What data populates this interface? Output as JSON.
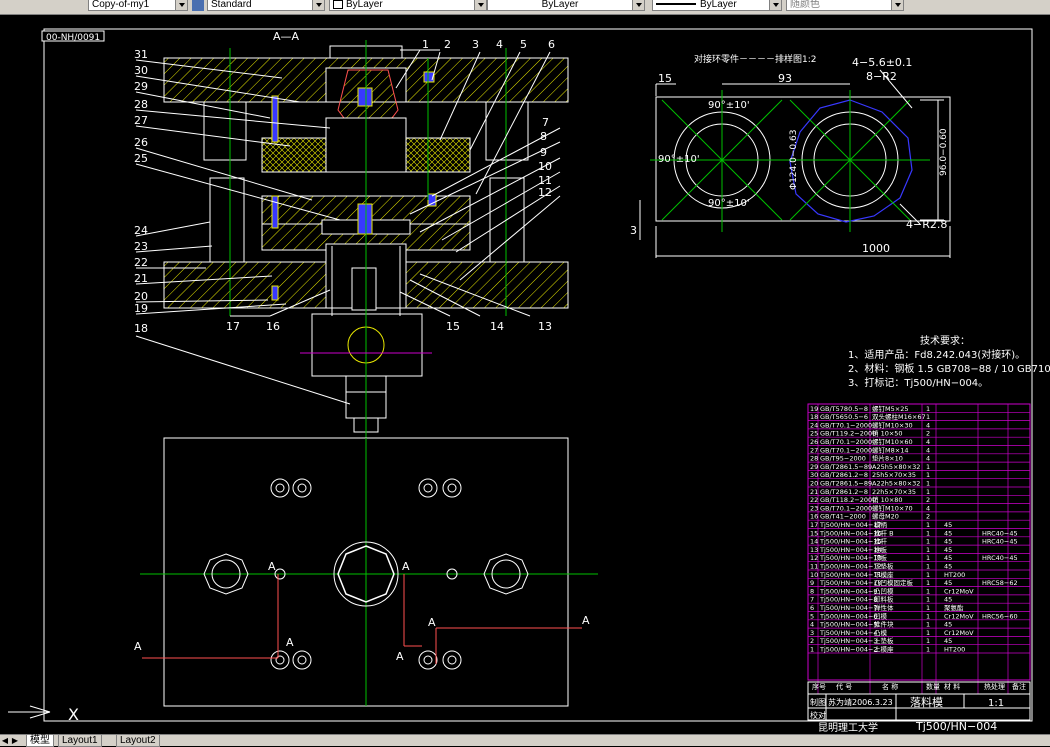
{
  "toolbar": {
    "layer_select": "Copy-of-my1",
    "text_style": "Standard",
    "color_control": "ByLayer",
    "linetype_control": "ByLayer",
    "lineweight_control": "ByLayer",
    "plot_style": "随颜色"
  },
  "drawing": {
    "top_label": "00-NH/0091",
    "section_label": "A—A",
    "part_numbers_left": [
      "31",
      "30",
      "29",
      "28",
      "27",
      "26",
      "25",
      "24",
      "23",
      "22",
      "21",
      "20",
      "19",
      "18"
    ],
    "part_numbers_top": [
      "1",
      "2",
      "3",
      "4",
      "5",
      "6"
    ],
    "part_numbers_right": [
      "7",
      "8",
      "9",
      "10",
      "11",
      "12"
    ],
    "part_numbers_bottom": [
      "17",
      "16",
      "15",
      "14",
      "13"
    ],
    "strip_title": "对接环零件－－－－排样图1:2",
    "dims": {
      "d15": "15",
      "d93": "93",
      "d_hole": "4−5.6±0.1",
      "d_r2": "8−R2",
      "a1": "90°±10'",
      "a2": "90°±10'",
      "a3": "90°±10'",
      "dia": "Φ124.0−0.63",
      "d96": "96.0−0.60",
      "d3": "3",
      "r28": "4−R2.8",
      "d1000": "1000"
    },
    "section_marks": [
      "A",
      "A",
      "A",
      "A",
      "A",
      "A",
      "A"
    ]
  },
  "tech": {
    "title": "技术要求：",
    "line1": "1、适用产品：Fd8.242.043(对接环)。",
    "line2": "2、材料：钢板 1.5 GB708−88 / 10 GB710−91",
    "line3": "3、打标记：Tj500/HN−004。"
  },
  "bom_std": [
    [
      "19",
      "GB/T5780.5−8",
      "螺钉M5×25",
      "1"
    ],
    [
      "18",
      "GB/T5650.5−6",
      "双头螺柱M16×67",
      "1"
    ],
    [
      "24",
      "GB/T70.1−2000",
      "螺钉M10×30",
      "4"
    ],
    [
      "25",
      "GB/T119.2−2000",
      "销 10×50",
      "2"
    ],
    [
      "26",
      "GB/T70.1−2000",
      "螺钉M10×60",
      "4"
    ],
    [
      "27",
      "GB/T70.1−2000",
      "螺钉M8×14",
      "4"
    ],
    [
      "28",
      "GB/T95−2000",
      "垫片8×10",
      "4"
    ],
    [
      "29",
      "GB/T2861.5−89",
      "A25h5×80×32",
      "1"
    ],
    [
      "30",
      "GB/T2861.2−8",
      "25h5×70×35",
      "1"
    ],
    [
      "20",
      "GB/T2861.5−89",
      "A22h5×80×32",
      "1"
    ],
    [
      "21",
      "GB/T2861.2−8",
      "22h5×70×35",
      "1"
    ],
    [
      "22",
      "GB/T118.2−2000",
      "销 10×80",
      "2"
    ],
    [
      "23",
      "GB/T70.1−2000",
      "螺钉M10×70",
      "4"
    ],
    [
      "16",
      "GB/T41−2000",
      "螺母M20",
      "2"
    ]
  ],
  "bom_parts": [
    [
      "17",
      "Tj500/HN−004−17",
      "模柄",
      "1",
      "45",
      ""
    ],
    [
      "15",
      "Tj500/HN−004−16",
      "推杆 B",
      "1",
      "45",
      "HRC40−45"
    ],
    [
      "14",
      "Tj500/HN−004−15",
      "推杆",
      "1",
      "45",
      "HRC40−45"
    ],
    [
      "13",
      "Tj500/HN−004−14",
      "推板",
      "1",
      "45",
      ""
    ],
    [
      "12",
      "Tj500/HN−004−13",
      "顶板",
      "1",
      "45",
      "HRC40−45"
    ],
    [
      "11",
      "Tj500/HN−004−12",
      "下垫板",
      "1",
      "45",
      ""
    ],
    [
      "10",
      "Tj500/HN−004−11",
      "下模座",
      "1",
      "HT200",
      ""
    ],
    [
      "9",
      "Tj500/HN−004−10",
      "凸凹模固定板",
      "1",
      "45",
      "HRC58−62"
    ],
    [
      "8",
      "Tj500/HN−004−9",
      "凸凹模",
      "1",
      "Cr12MoV",
      ""
    ],
    [
      "7",
      "Tj500/HN−004−8",
      "卸料板",
      "1",
      "45",
      ""
    ],
    [
      "6",
      "Tj500/HN−004−7",
      "弹性体",
      "1",
      "聚氨酯",
      ""
    ],
    [
      "5",
      "Tj500/HN−004−6",
      "凹模",
      "1",
      "Cr12MoV",
      "HRC56−60"
    ],
    [
      "4",
      "Tj500/HN−004−5",
      "推件块",
      "1",
      "45",
      ""
    ],
    [
      "3",
      "Tj500/HN−004−4",
      "凸模",
      "1",
      "Cr12MoV",
      ""
    ],
    [
      "2",
      "Tj500/HN−004−3",
      "上垫板",
      "1",
      "45",
      ""
    ],
    [
      "1",
      "Tj500/HN−004−2",
      "上模座",
      "1",
      "HT200",
      ""
    ]
  ],
  "bom_header": {
    "c1": "序号",
    "c2": "代 号",
    "c3": "名 称",
    "c4": "数量",
    "c5": "材 料",
    "c6": "热处理",
    "c7": "备注"
  },
  "title_block": {
    "designed_label": "制图",
    "designer": "苏为靖2006.3.23",
    "check_label": "校对",
    "name": "落料模",
    "scale": "1:1",
    "school": "昆明理工大学",
    "code": "Tj500/HN−004"
  },
  "tabs": {
    "model": "模型",
    "layout1": "Layout1",
    "layout2": "Layout2"
  },
  "ucs_label": "X",
  "colors": {
    "green": "#00c000",
    "yellow": "#e8e800",
    "white": "#ffffff",
    "magenta": "#cc00cc",
    "blue": "#3838ff",
    "red": "#ff5050",
    "cyan": "#00e0e0"
  }
}
